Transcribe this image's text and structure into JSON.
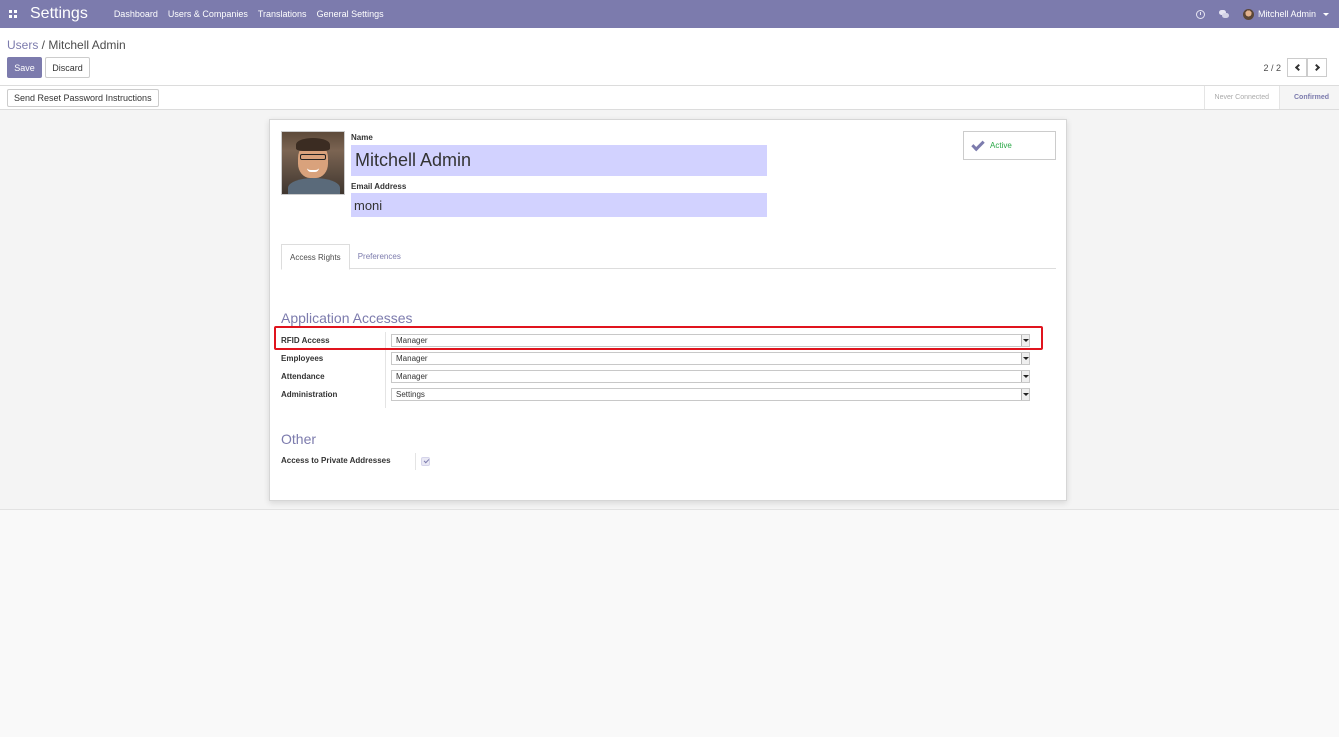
{
  "navbar": {
    "app_title": "Settings",
    "menu": [
      "Dashboard",
      "Users & Companies",
      "Translations",
      "General Settings"
    ],
    "user_name": "Mitchell Admin",
    "bg_color": "#7c7bad"
  },
  "breadcrumb": {
    "parent": "Users",
    "separator": " / ",
    "current": "Mitchell Admin"
  },
  "buttons": {
    "save": "Save",
    "discard": "Discard",
    "reset_password": "Send Reset Password Instructions"
  },
  "pager": {
    "value": "2 / 2"
  },
  "status": {
    "steps": [
      "Never Connected",
      "Confirmed"
    ],
    "current": "Confirmed"
  },
  "form": {
    "name_label": "Name",
    "name_value": "Mitchell Admin",
    "email_label": "Email Address",
    "email_value": "moni",
    "active_label": "Active",
    "tabs": [
      "Access Rights",
      "Preferences"
    ],
    "active_tab": "Access Rights",
    "app_accesses_title": "Application Accesses",
    "accesses": [
      {
        "label": "RFID Access",
        "value": "Manager"
      },
      {
        "label": "Employees",
        "value": "Manager"
      },
      {
        "label": "Attendance",
        "value": "Manager"
      },
      {
        "label": "Administration",
        "value": "Settings"
      }
    ],
    "other_title": "Other",
    "private_addresses_label": "Access to Private Addresses",
    "private_addresses_checked": true
  },
  "colors": {
    "accent": "#7c7bad",
    "input_highlight": "#d2d2ff",
    "active_green": "#28a745",
    "annotation_red": "#e0141e"
  }
}
